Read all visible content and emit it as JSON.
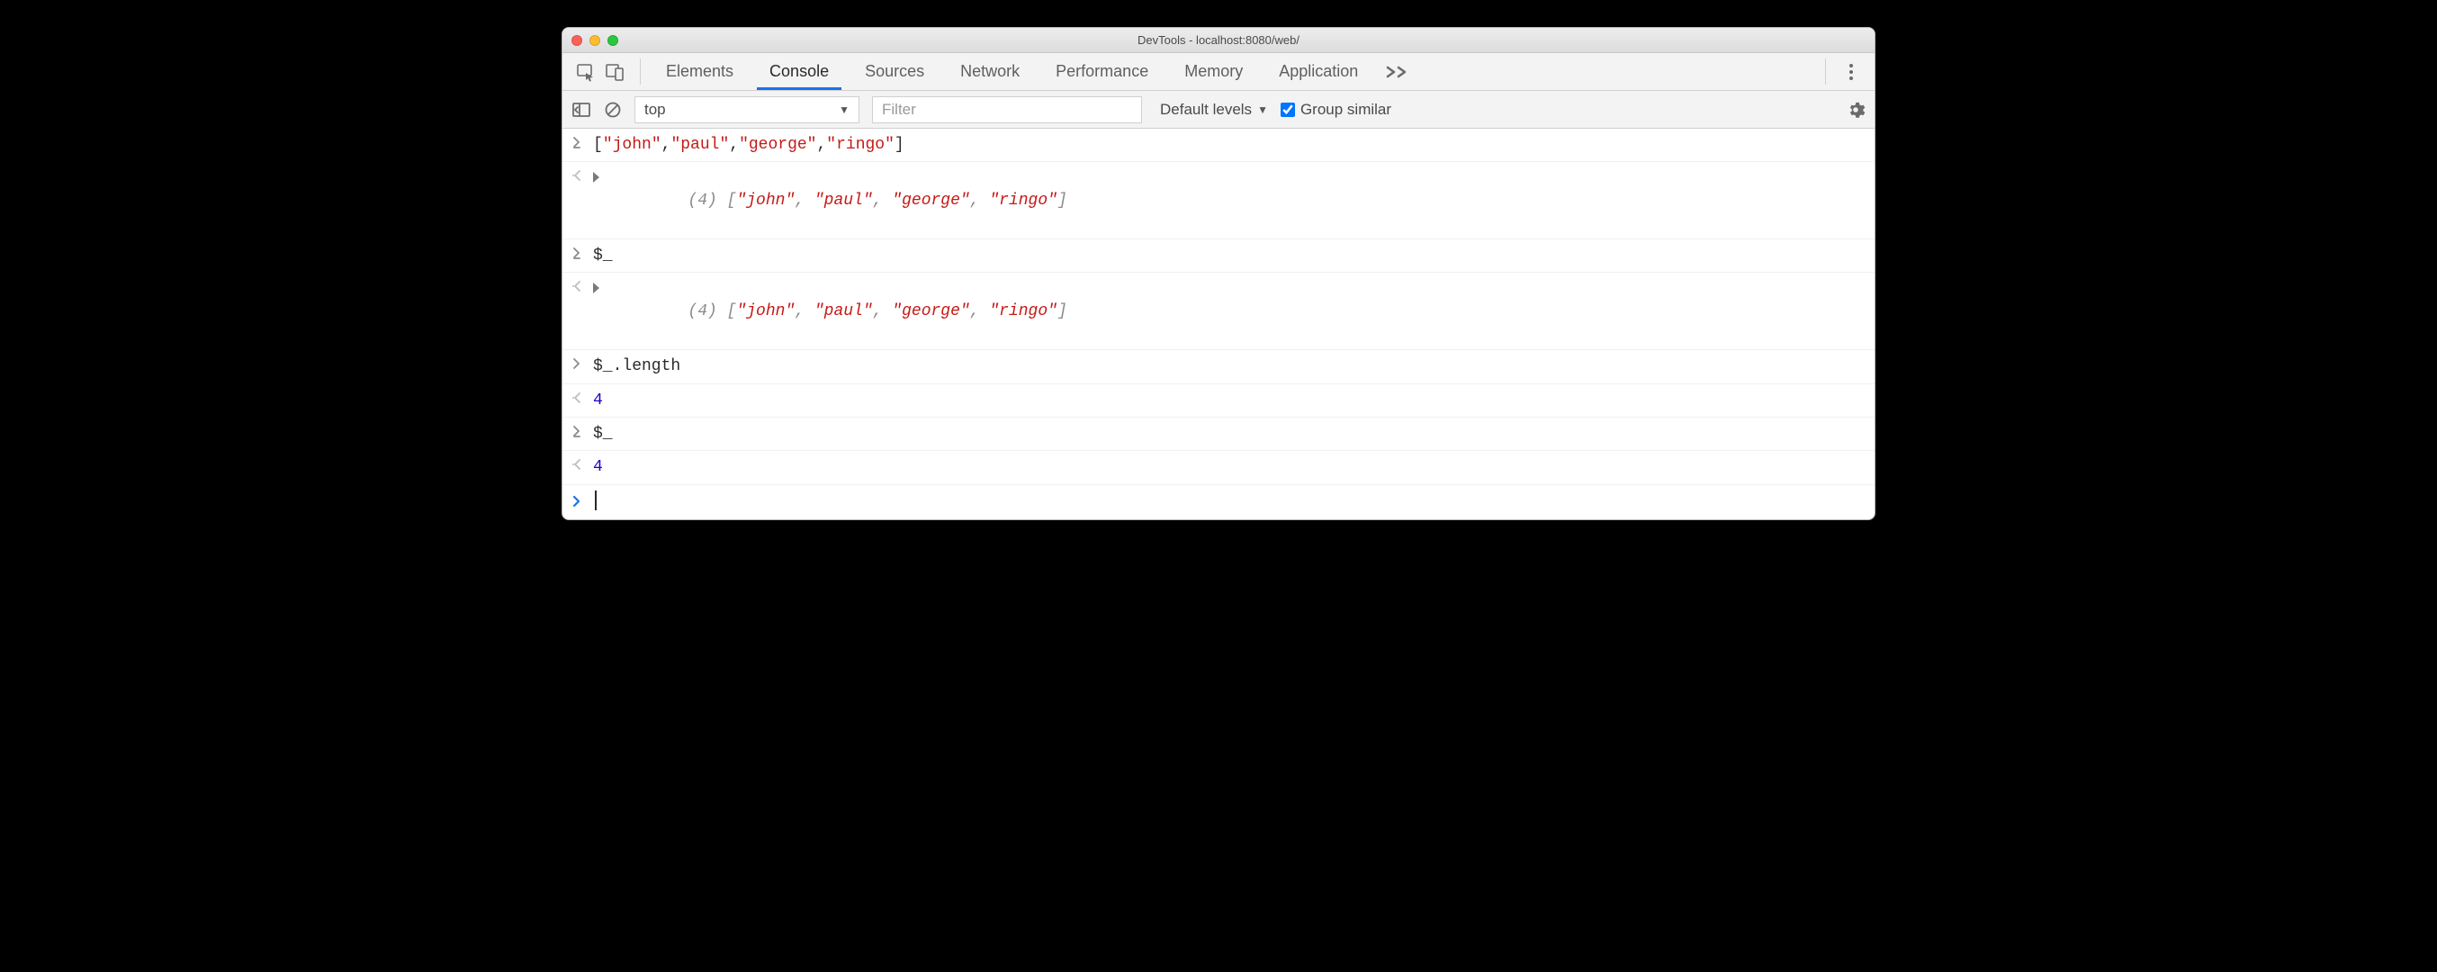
{
  "title": "DevTools - localhost:8080/web/",
  "tabs": {
    "elements": "Elements",
    "console": "Console",
    "sources": "Sources",
    "network": "Network",
    "performance": "Performance",
    "memory": "Memory",
    "application": "Application"
  },
  "filterbar": {
    "context": "top",
    "filter_placeholder": "Filter",
    "levels": "Default levels",
    "group_similar": "Group similar"
  },
  "rows": {
    "r0": {
      "input_tokens": [
        {
          "t": "[",
          "c": "tok-plain"
        },
        {
          "t": "\"john\"",
          "c": "tok-str"
        },
        {
          "t": ",",
          "c": "tok-plain"
        },
        {
          "t": "\"paul\"",
          "c": "tok-str"
        },
        {
          "t": ",",
          "c": "tok-plain"
        },
        {
          "t": "\"george\"",
          "c": "tok-str"
        },
        {
          "t": ",",
          "c": "tok-plain"
        },
        {
          "t": "\"ringo\"",
          "c": "tok-str"
        },
        {
          "t": "]",
          "c": "tok-plain"
        }
      ]
    },
    "r1": {
      "count": "(4) ",
      "tokens": [
        {
          "t": "[",
          "c": "tok-dim"
        },
        {
          "t": "\"john\"",
          "c": "tok-str italic"
        },
        {
          "t": ", ",
          "c": "tok-dim"
        },
        {
          "t": "\"paul\"",
          "c": "tok-str italic"
        },
        {
          "t": ", ",
          "c": "tok-dim"
        },
        {
          "t": "\"george\"",
          "c": "tok-str italic"
        },
        {
          "t": ", ",
          "c": "tok-dim"
        },
        {
          "t": "\"ringo\"",
          "c": "tok-str italic"
        },
        {
          "t": "]",
          "c": "tok-dim"
        }
      ]
    },
    "r2": {
      "input": "$_"
    },
    "r3": {
      "count": "(4) ",
      "tokens": [
        {
          "t": "[",
          "c": "tok-dim"
        },
        {
          "t": "\"john\"",
          "c": "tok-str italic"
        },
        {
          "t": ", ",
          "c": "tok-dim"
        },
        {
          "t": "\"paul\"",
          "c": "tok-str italic"
        },
        {
          "t": ", ",
          "c": "tok-dim"
        },
        {
          "t": "\"george\"",
          "c": "tok-str italic"
        },
        {
          "t": ", ",
          "c": "tok-dim"
        },
        {
          "t": "\"ringo\"",
          "c": "tok-str italic"
        },
        {
          "t": "]",
          "c": "tok-dim"
        }
      ]
    },
    "r4": {
      "input": "$_.length"
    },
    "r5": {
      "value": "4"
    },
    "r6": {
      "input": "$_"
    },
    "r7": {
      "value": "4"
    }
  }
}
